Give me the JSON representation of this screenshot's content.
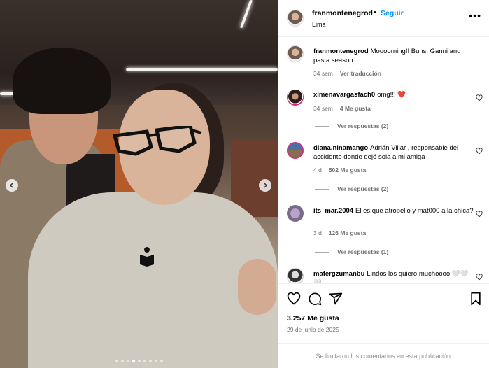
{
  "post": {
    "photo": {
      "carousel_dots": 9,
      "active_dot": 3
    },
    "header": {
      "username": "franmontenegrod",
      "separator": "•",
      "follow_label": "Seguir",
      "location": "Lima",
      "more_label": "•••"
    },
    "caption": {
      "username": "franmontenegrod",
      "text": "Moooorning!! Buns, Ganni and pasta season",
      "time": "34 sem",
      "translate": "Ver traducción"
    },
    "comments": [
      {
        "username": "ximenavargasfach0",
        "text": "omg!!! ❤️",
        "time": "34 sem",
        "likes": "4 Me gusta",
        "replies": "Ver respuestas (2)"
      },
      {
        "username": "diana.ninamango",
        "text": "Adrián Villar , responsable del accidente donde dejó sola a mi amiga",
        "time": "4 d",
        "likes": "502 Me gusta",
        "replies": "Ver respuestas (2)"
      },
      {
        "username": "its_mar.2004",
        "text": "El es que atropello y mat000 a la chica?",
        "time": "3 d",
        "likes": "126 Me gusta",
        "replies": "Ver respuestas (1)"
      },
      {
        "username": "mafergzumanbu",
        "text": "Lindos los quiero muchoooo 🤍🤍🤍",
        "time": "",
        "likes": "",
        "replies": ""
      }
    ],
    "likes_count": "3.257 Me gusta",
    "date": "29 de junio de 2025",
    "comments_limited": "Se limitaron los comentarios en esta publicación."
  },
  "colors": {
    "accent": "#0095f6",
    "muted": "#737373",
    "border": "#dbdbdb"
  }
}
